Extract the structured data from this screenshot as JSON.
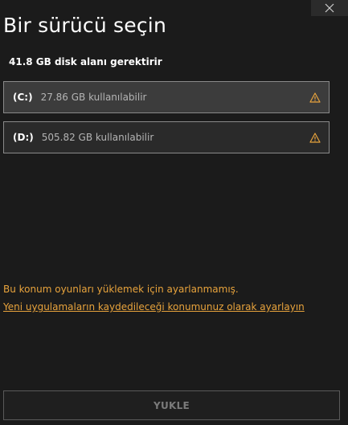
{
  "window": {
    "close_icon": "close-icon"
  },
  "title": "Bir sürücü seçin",
  "requirement": "41.8 GB disk alanı gerektirir",
  "drives": [
    {
      "letter": "(C:)",
      "free_space": "27.86 GB kullanılabilir",
      "selected": true,
      "warning_icon": "warning-icon"
    },
    {
      "letter": "(D:)",
      "free_space": "505.82 GB kullanılabilir",
      "selected": false,
      "warning_icon": "warning-icon"
    }
  ],
  "notice": {
    "message": "Bu konum oyunları yüklemek için ayarlanmamış.",
    "link": "Yeni uygulamaların kaydedileceği konumunuz olarak ayarlayın"
  },
  "install_button": "YUKLE",
  "colors": {
    "background": "#1b1b1b",
    "warning": "#e8a33c",
    "selected_drive": "#3c3c3c",
    "drive": "#2a2a2a",
    "disabled_text": "#7a7a7a"
  }
}
